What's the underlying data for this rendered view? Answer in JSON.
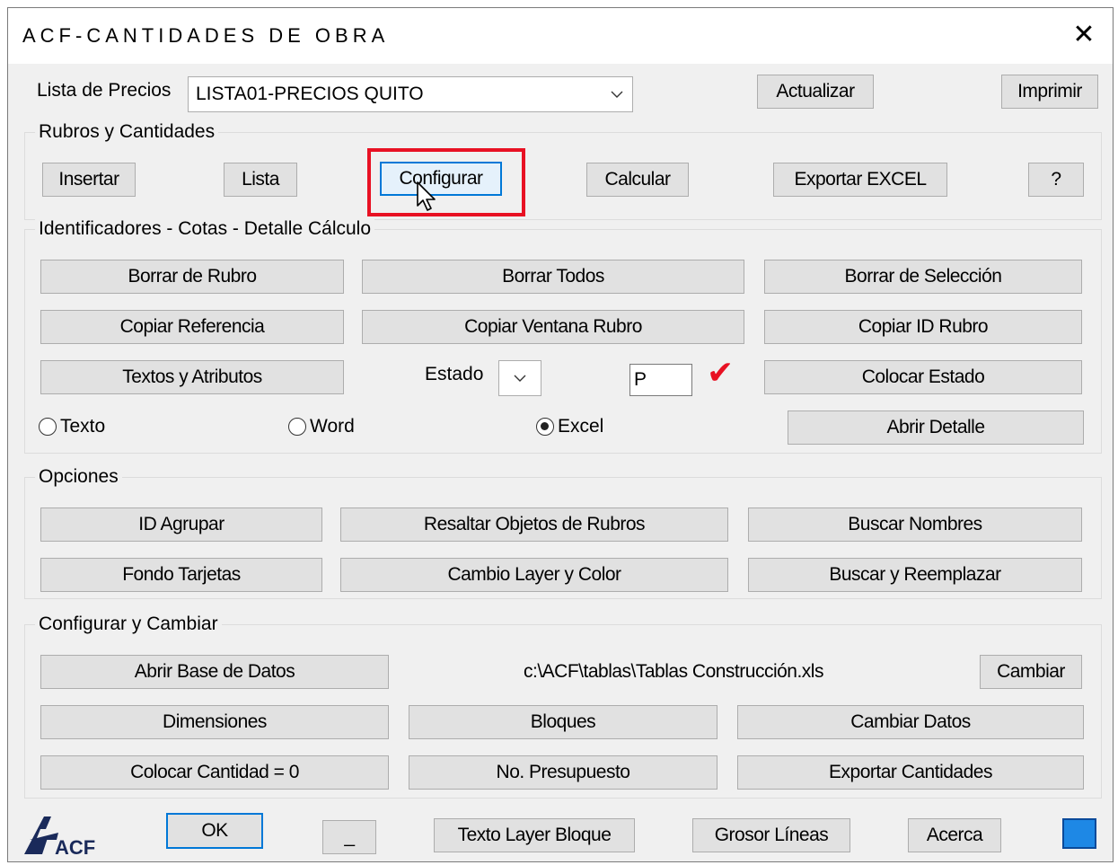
{
  "window": {
    "title": "ACF-CANTIDADES DE OBRA",
    "close_glyph": "✕"
  },
  "precios": {
    "label": "Lista de Precios",
    "selected": "LISTA01-PRECIOS QUITO",
    "actualizar": "Actualizar",
    "imprimir": "Imprimir"
  },
  "rubros": {
    "legend": "Rubros y Cantidades",
    "insertar": "Insertar",
    "lista": "Lista",
    "configurar": "Configurar",
    "calcular": "Calcular",
    "exportar_excel": "Exportar EXCEL",
    "help": "?"
  },
  "identificadores": {
    "legend": "Identificadores - Cotas - Detalle Cálculo",
    "borrar_rubro": "Borrar de Rubro",
    "borrar_todos": "Borrar Todos",
    "borrar_seleccion": "Borrar de Selección",
    "copiar_referencia": "Copiar Referencia",
    "copiar_ventana": "Copiar Ventana Rubro",
    "copiar_id": "Copiar ID Rubro",
    "textos_atributos": "Textos y Atributos",
    "estado_label": "Estado",
    "estado_value": "P",
    "check_glyph": "✔",
    "colocar_estado": "Colocar Estado",
    "radio_texto": "Texto",
    "radio_word": "Word",
    "radio_excel": "Excel",
    "abrir_detalle": "Abrir Detalle"
  },
  "opciones": {
    "legend": "Opciones",
    "id_agrupar": "ID Agrupar",
    "resaltar": "Resaltar Objetos de Rubros",
    "buscar_nombres": "Buscar Nombres",
    "fondo_tarjetas": "Fondo Tarjetas",
    "cambio_layer": "Cambio Layer y Color",
    "buscar_reemplazar": "Buscar y Reemplazar"
  },
  "configurar": {
    "legend": "Configurar y Cambiar",
    "abrir_bd": "Abrir Base de Datos",
    "path": "c:\\ACF\\tablas\\Tablas Construcción.xls",
    "cambiar": "Cambiar",
    "dimensiones": "Dimensiones",
    "bloques": "Bloques",
    "cambiar_datos": "Cambiar Datos",
    "colocar_cantidad": "Colocar Cantidad = 0",
    "no_presupuesto": "No. Presupuesto",
    "exportar_cantidades": "Exportar Cantidades"
  },
  "footer": {
    "logo_text": "ACF",
    "ok": "OK",
    "minimize": "_",
    "texto_layer": "Texto Layer Bloque",
    "grosor": "Grosor Líneas",
    "acerca": "Acerca"
  },
  "colors": {
    "highlight": "#e81123",
    "check": "#e81123",
    "accent": "#0078d7"
  }
}
